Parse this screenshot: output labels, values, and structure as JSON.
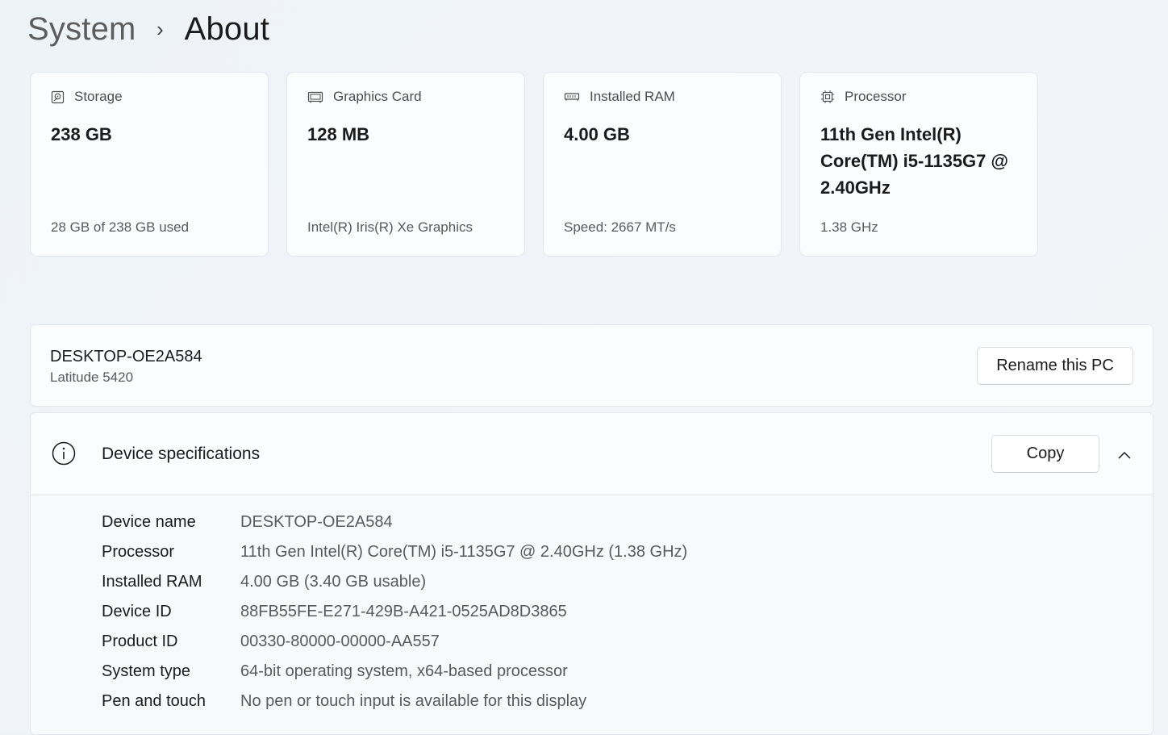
{
  "breadcrumb": {
    "parent": "System",
    "separator": "›",
    "current": "About"
  },
  "cards": [
    {
      "icon": "storage-icon",
      "label": "Storage",
      "value": "238 GB",
      "sub": "28 GB of 238 GB used"
    },
    {
      "icon": "graphics-card-icon",
      "label": "Graphics Card",
      "value": "128 MB",
      "sub": "Intel(R) Iris(R) Xe Graphics"
    },
    {
      "icon": "ram-icon",
      "label": "Installed RAM",
      "value": "4.00 GB",
      "sub": "Speed: 2667 MT/s"
    },
    {
      "icon": "processor-icon",
      "label": "Processor",
      "value": "11th Gen Intel(R) Core(TM) i5-1135G7 @ 2.40GHz",
      "sub": "1.38 GHz"
    }
  ],
  "device": {
    "name": "DESKTOP-OE2A584",
    "model": "Latitude 5420",
    "rename_label": "Rename this PC"
  },
  "specs": {
    "title": "Device specifications",
    "copy_label": "Copy",
    "icons": {
      "info": "info-icon",
      "toggle": "chevron-up-icon"
    },
    "rows": [
      {
        "label": "Device name",
        "value": "DESKTOP-OE2A584"
      },
      {
        "label": "Processor",
        "value": "11th Gen Intel(R) Core(TM) i5-1135G7 @ 2.40GHz (1.38 GHz)"
      },
      {
        "label": "Installed RAM",
        "value": "4.00 GB (3.40 GB usable)"
      },
      {
        "label": "Device ID",
        "value": "88FB55FE-E271-429B-A421-0525AD8D3865"
      },
      {
        "label": "Product ID",
        "value": "00330-80000-00000-AA557"
      },
      {
        "label": "System type",
        "value": "64-bit operating system, x64-based processor"
      },
      {
        "label": "Pen and touch",
        "value": "No pen or touch input is available for this display"
      }
    ]
  },
  "colors": {
    "background": "#f0f4f8",
    "card": "#fbfcfd",
    "border": "#e3e6ea",
    "text_primary": "#1b1b1b",
    "text_secondary": "#5a5a5a"
  }
}
